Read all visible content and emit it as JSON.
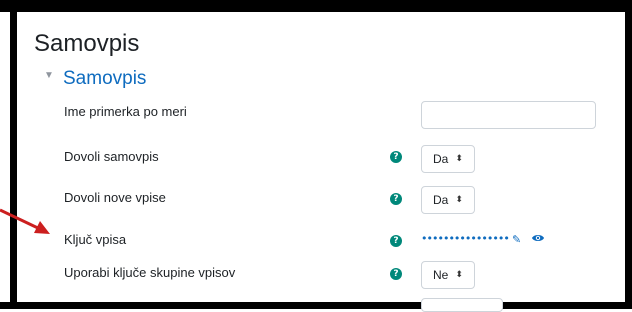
{
  "page": {
    "title": "Samovpis"
  },
  "section": {
    "title": "Samovpis"
  },
  "form": {
    "instance_name": {
      "label": "Ime primerka po meri",
      "value": ""
    },
    "allow_self_enrol": {
      "label": "Dovoli samovpis",
      "value": "Da"
    },
    "allow_new_enrol": {
      "label": "Dovoli nove vpise",
      "value": "Da"
    },
    "enrolment_key": {
      "label": "Ključ vpisa",
      "masked_value": "••••••••••••••••"
    },
    "use_group_keys": {
      "label": "Uporabi ključe skupine vpisov",
      "value": "Ne"
    }
  },
  "icons": {
    "help": "question-circle-icon",
    "edit": "pencil-icon",
    "reveal": "eye-icon",
    "toggle": "caret-down-icon"
  },
  "colors": {
    "accent": "#0f6cbf",
    "help": "#00887a",
    "annotation_arrow": "#cc1f1f"
  }
}
